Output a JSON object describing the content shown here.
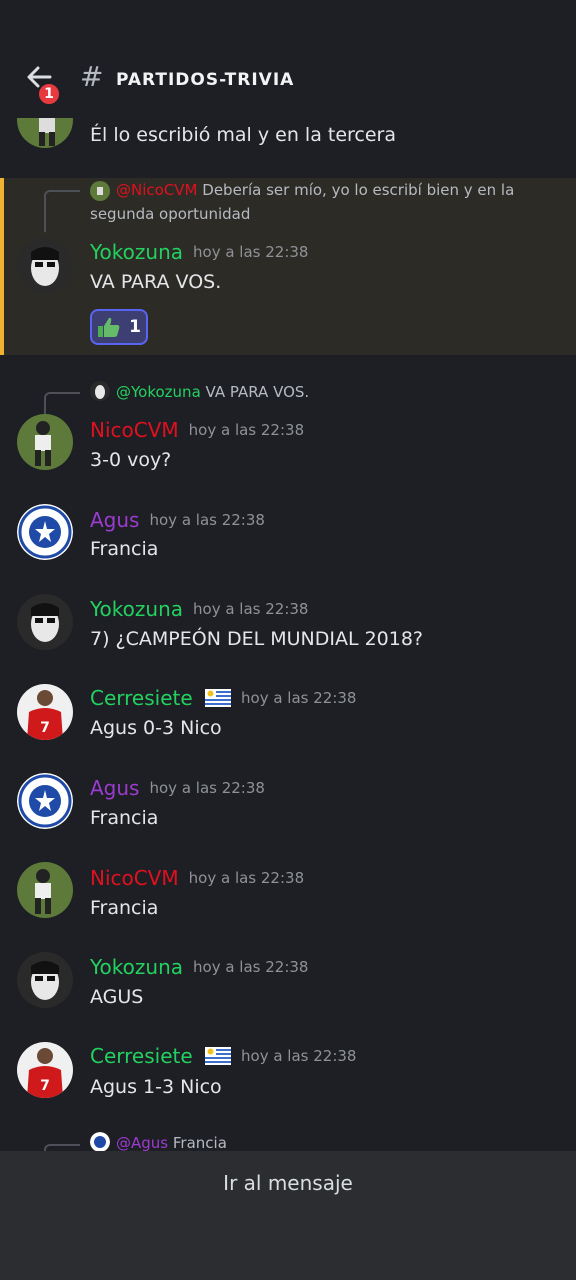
{
  "header": {
    "channel": "PARTIDOS-TRIVIA",
    "notifications": "1"
  },
  "colors": {
    "yokozuna": "#23d160",
    "nico": "#e0111e",
    "agus": "#9b3bd0",
    "cerre": "#23d160",
    "accent": "#f0b232"
  },
  "messages": [
    {
      "content": "Él lo escribió mal y en la tercera"
    },
    {
      "reply_user": "@NicoCVM",
      "reply_text": "Debería ser mío, yo lo escribí bien y en la segunda oportunidad",
      "user": "Yokozuna",
      "time": "hoy a las 22:38",
      "content": "VA PARA VOS.",
      "reaction_count": "1"
    },
    {
      "reply_user": "@Yokozuna",
      "reply_text": "VA PARA VOS.",
      "user": "NicoCVM",
      "time": "hoy a las 22:38",
      "content": "3-0 voy?"
    },
    {
      "user": "Agus",
      "time": "hoy a las 22:38",
      "content": "Francia"
    },
    {
      "user": "Yokozuna",
      "time": "hoy a las 22:38",
      "content": "7) ¿CAMPEÓN DEL MUNDIAL 2018?"
    },
    {
      "user": "Cerresiete",
      "time": "hoy a las 22:38",
      "content": "Agus 0-3 Nico"
    },
    {
      "user": "Agus",
      "time": "hoy a las 22:38",
      "content": "Francia"
    },
    {
      "user": "NicoCVM",
      "time": "hoy a las 22:38",
      "content": "Francia"
    },
    {
      "user": "Yokozuna",
      "time": "hoy a las 22:38",
      "content": "AGUS"
    },
    {
      "user": "Cerresiete",
      "time": "hoy a las 22:38",
      "content": "Agus 1-3 Nico"
    },
    {
      "reply_user": "@Agus",
      "reply_text": "Francia"
    }
  ],
  "footer": {
    "jump_label": "Ir al mensaje"
  }
}
